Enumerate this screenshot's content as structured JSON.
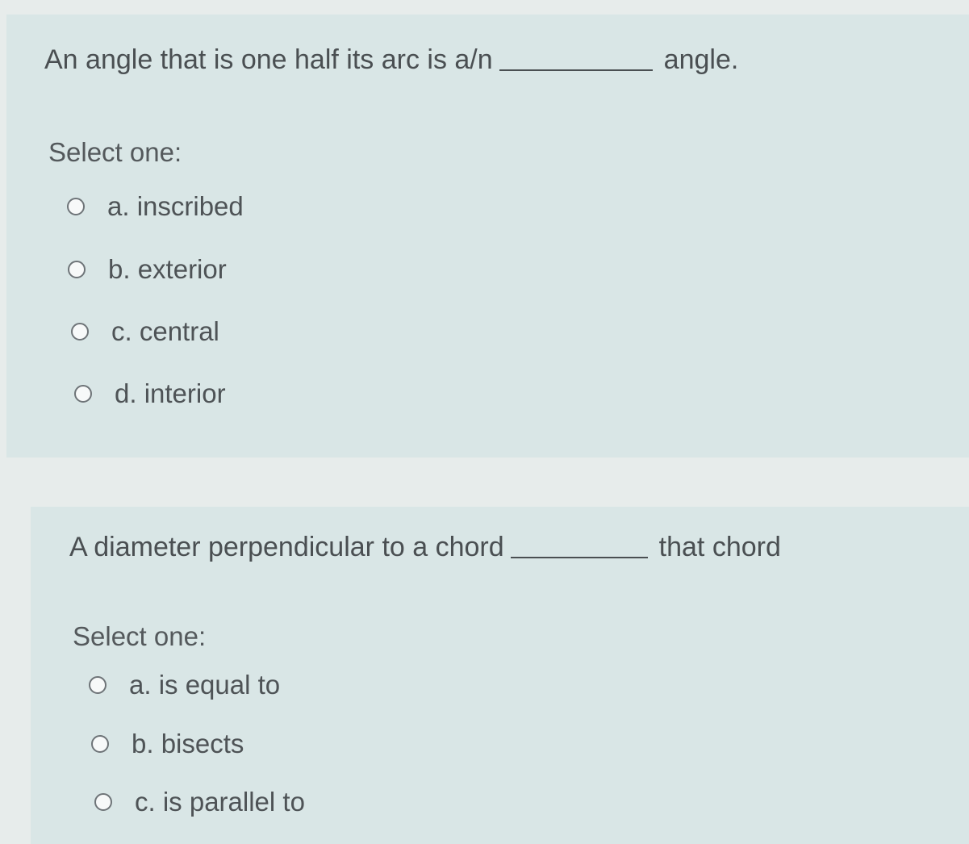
{
  "questions": [
    {
      "prompt_before": "An angle that is one half its arc is a/n",
      "prompt_after": "angle.",
      "select_label": "Select one:",
      "options": [
        {
          "label": "a. inscribed"
        },
        {
          "label": "b. exterior"
        },
        {
          "label": "c. central"
        },
        {
          "label": "d. interior"
        }
      ]
    },
    {
      "prompt_before": "A diameter perpendicular to a chord",
      "prompt_after": "that chord",
      "select_label": "Select one:",
      "options": [
        {
          "label": "a. is equal to"
        },
        {
          "label": "b. bisects"
        },
        {
          "label": "c. is parallel to"
        }
      ]
    }
  ]
}
